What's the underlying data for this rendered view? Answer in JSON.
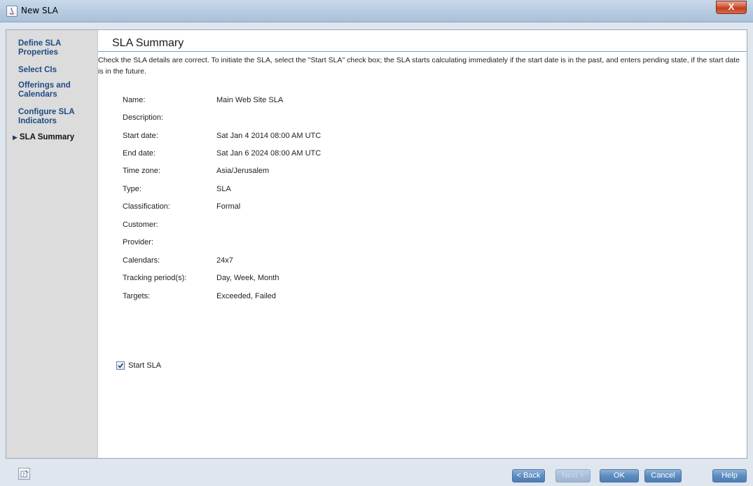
{
  "window": {
    "title": "New SLA",
    "close_symbol": "X"
  },
  "sidebar": {
    "items": [
      {
        "label": "Define SLA Properties"
      },
      {
        "label": "Select CIs"
      },
      {
        "label": "Offerings and Calendars"
      },
      {
        "label": "Configure SLA Indicators"
      },
      {
        "label": "SLA Summary",
        "current": true
      }
    ]
  },
  "main": {
    "title": "SLA Summary",
    "description": "Check the SLA details are correct. To initiate the SLA, select the \"Start SLA\" check box; the SLA starts calculating immediately if the start date is in the past, and enters pending state, if the start date is in the future.",
    "fields": [
      {
        "label": "Name:",
        "value": "Main Web Site SLA"
      },
      {
        "label": "Description:",
        "value": ""
      },
      {
        "label": "Start date:",
        "value": "Sat Jan 4 2014 08:00 AM UTC"
      },
      {
        "label": "End date:",
        "value": "Sat Jan 6 2024 08:00 AM UTC"
      },
      {
        "label": "Time zone:",
        "value": "Asia/Jerusalem"
      },
      {
        "label": "Type:",
        "value": "SLA"
      },
      {
        "label": "Classification:",
        "value": "Formal"
      },
      {
        "label": "Customer:",
        "value": ""
      },
      {
        "label": "Provider:",
        "value": ""
      },
      {
        "label": "Calendars:",
        "value": "24x7"
      },
      {
        "label": "Tracking period(s):",
        "value": "Day, Week, Month"
      },
      {
        "label": "Targets:",
        "value": "Exceeded, Failed"
      }
    ],
    "start_sla": {
      "label": "Start SLA",
      "checked": true
    }
  },
  "buttons": {
    "back": "< Back",
    "next": "Next >",
    "ok": "OK",
    "cancel": "Cancel",
    "help": "Help"
  },
  "colors": {
    "accent_blue": "#5d8cc0",
    "sidebar_link": "#1e4b86",
    "sidebar_bg": "#dcdcdc",
    "window_bg": "#dfe6ee"
  }
}
